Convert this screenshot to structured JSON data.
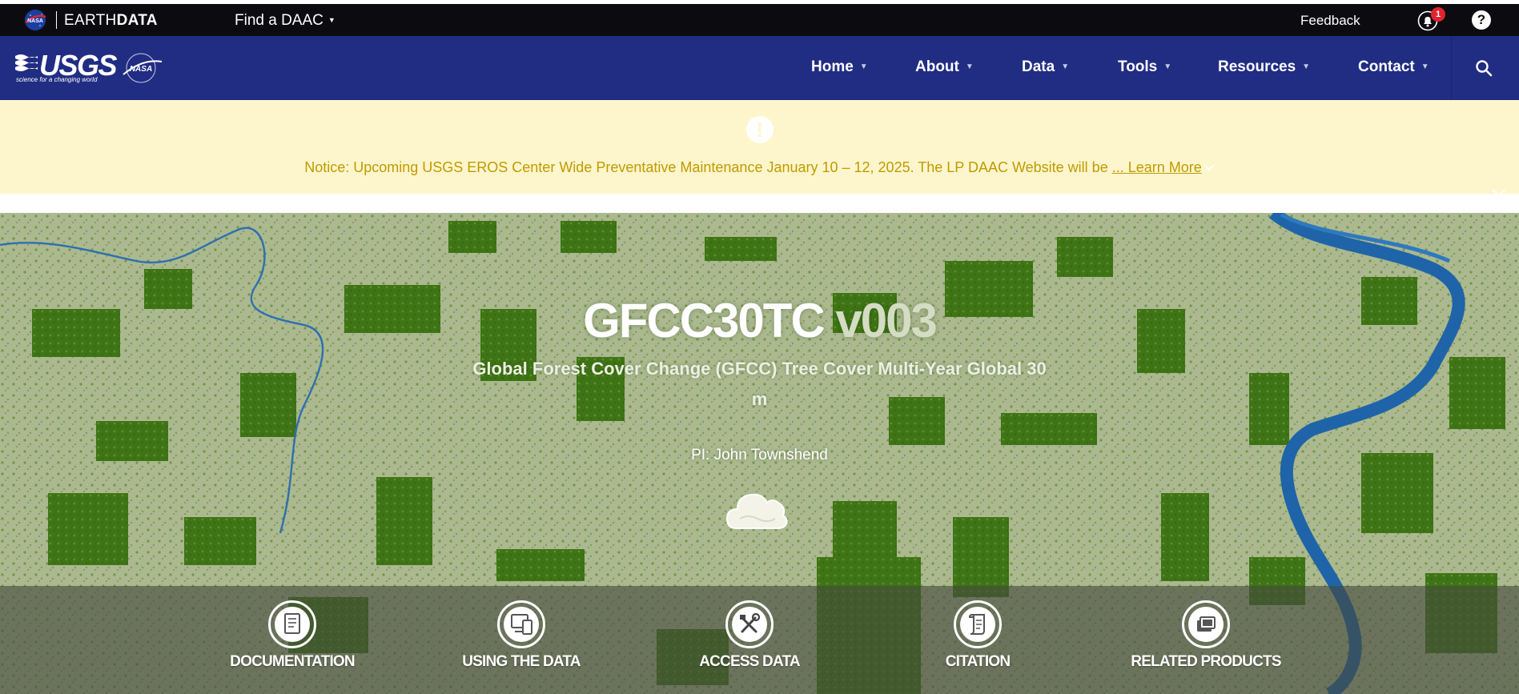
{
  "earthdata_bar": {
    "nasa_logo_text": "NASA",
    "brand_light": "EARTH",
    "brand_bold": "DATA",
    "find_daac_label": "Find a DAAC",
    "feedback_label": "Feedback",
    "notification_count": "1",
    "help_label": "?"
  },
  "usgs_nav": {
    "usgs_wordmark": "USGS",
    "usgs_tagline": "science for a changing world",
    "nasa_logo_text": "NASA",
    "items": [
      {
        "label": "Home"
      },
      {
        "label": "About"
      },
      {
        "label": "Data"
      },
      {
        "label": "Tools"
      },
      {
        "label": "Resources"
      },
      {
        "label": "Contact"
      }
    ]
  },
  "notice": {
    "icon_text": "!",
    "text": "Notice: Upcoming USGS EROS Center Wide Preventative Maintenance January 10 – 12, 2025. The LP DAAC Website will be",
    "learn_more": "... Learn More"
  },
  "hero": {
    "title": "GFCC30TC",
    "version": "v003",
    "subtitle": "Global Forest Cover Change (GFCC) Tree Cover Multi-Year Global 30 m",
    "pi": "PI: John Townshend",
    "tabs": [
      {
        "label": "DOCUMENTATION",
        "icon": "document-icon"
      },
      {
        "label": "USING THE DATA",
        "icon": "devices-icon"
      },
      {
        "label": "ACCESS DATA",
        "icon": "tools-icon"
      },
      {
        "label": "CITATION",
        "icon": "scroll-icon"
      },
      {
        "label": "RELATED PRODUCTS",
        "icon": "layers-icon"
      }
    ]
  },
  "colors": {
    "earthdata_bar": "#0c0c10",
    "usgs_nav": "#212d83",
    "notice_bg": "#fdf6cc",
    "notice_text": "#c19a00",
    "hero_forest": "#4a7a1c",
    "hero_river": "#1f64a8"
  }
}
